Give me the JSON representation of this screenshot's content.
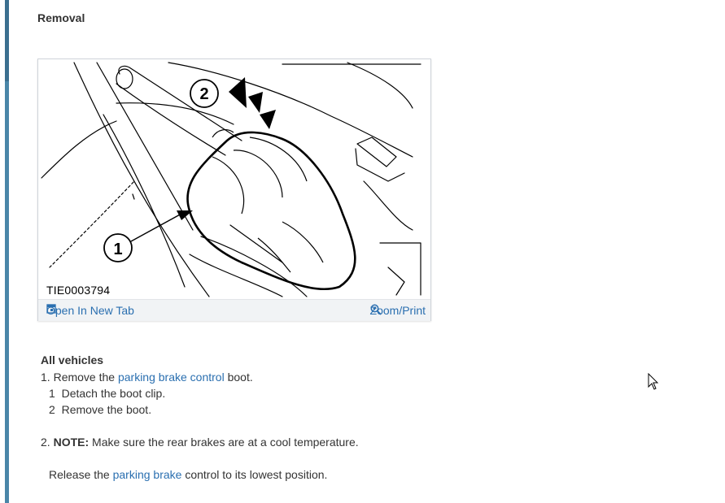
{
  "page": {
    "section_title": "Removal"
  },
  "figure": {
    "image_id": "TIE0003794",
    "callouts": [
      "1",
      "2"
    ],
    "open_label": "Open In New Tab",
    "zoom_label": "Zoom/Print",
    "open_icon": "new-tab-icon",
    "zoom_icon": "zoom-in-icon"
  },
  "instructions": {
    "heading": "All vehicles",
    "step1": {
      "num": "1.",
      "pre": "Remove the",
      "link": "parking brake control",
      "post": "boot.",
      "substeps": [
        {
          "num": "1",
          "text": "Detach the boot clip."
        },
        {
          "num": "2",
          "text": "Remove the boot."
        }
      ]
    },
    "step2": {
      "num": "2.",
      "note_label": "NOTE:",
      "note_text": "Make sure the rear brakes are at a cool temperature.",
      "pre": "Release the",
      "link": "parking brake",
      "post": "control to its lowest position."
    }
  },
  "colors": {
    "link": "#2a6fb0",
    "rail": "#4a86a8",
    "toolbar_bg": "#f1f3f5"
  }
}
